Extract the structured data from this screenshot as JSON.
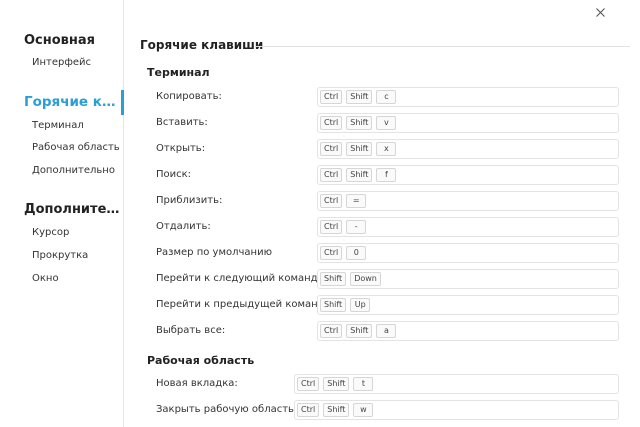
{
  "sidebar": {
    "groups": [
      {
        "title": "Основная",
        "items": [
          "Интерфейс"
        ]
      },
      {
        "title": "Горячие клав...",
        "items": [
          "Терминал",
          "Рабочая область",
          "Дополнительно"
        ]
      },
      {
        "title": "Дополнитель...",
        "items": [
          "Курсор",
          "Прокрутка",
          "Окно"
        ]
      }
    ],
    "accent_color": "#2a9fd6"
  },
  "close_icon": "close-icon",
  "content": {
    "title": "Горячие клавиши",
    "sections": [
      {
        "title": "Терминал",
        "rows": [
          {
            "label": "Копировать:",
            "keys": [
              "Ctrl",
              "Shift",
              "c"
            ]
          },
          {
            "label": "Вставить:",
            "keys": [
              "Ctrl",
              "Shift",
              "v"
            ]
          },
          {
            "label": "Открыть:",
            "keys": [
              "Ctrl",
              "Shift",
              "x"
            ]
          },
          {
            "label": "Поиск:",
            "keys": [
              "Ctrl",
              "Shift",
              "f"
            ]
          },
          {
            "label": "Приблизить:",
            "keys": [
              "Ctrl",
              "="
            ]
          },
          {
            "label": "Отдалить:",
            "keys": [
              "Ctrl",
              "-"
            ]
          },
          {
            "label": "Размер по умолчанию",
            "keys": [
              "Ctrl",
              "0"
            ]
          },
          {
            "label": "Перейти к следующий команде:",
            "keys": [
              "Shift",
              "Down"
            ]
          },
          {
            "label": "Перейти к предыдущей команде:",
            "keys": [
              "Shift",
              "Up"
            ]
          },
          {
            "label": "Выбрать все:",
            "keys": [
              "Ctrl",
              "Shift",
              "a"
            ]
          }
        ]
      },
      {
        "title": "Рабочая область",
        "rows": [
          {
            "label": "Новая вкладка:",
            "keys": [
              "Ctrl",
              "Shift",
              "t"
            ]
          },
          {
            "label": "Закрыть рабочую область:",
            "keys": [
              "Ctrl",
              "Shift",
              "w"
            ]
          }
        ]
      }
    ]
  }
}
